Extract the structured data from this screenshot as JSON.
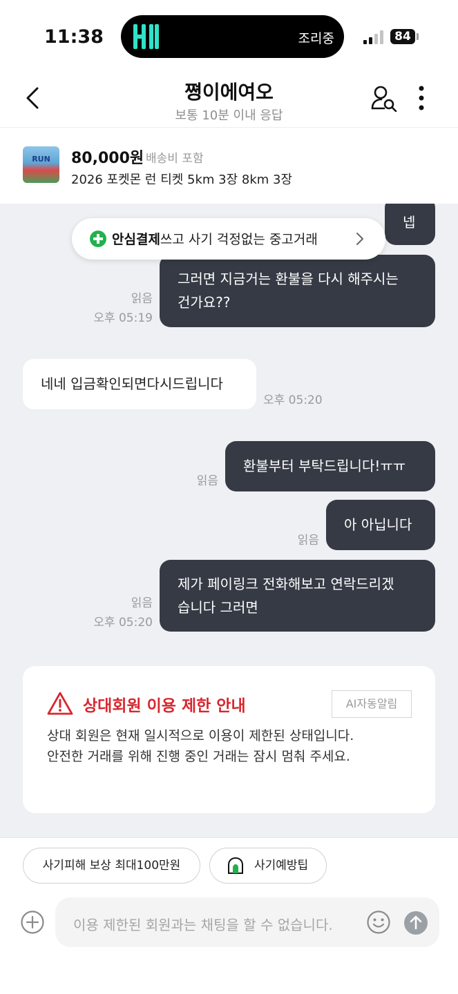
{
  "status_bar": {
    "time": "11:38",
    "live_activity_text": "조리중",
    "battery": "84"
  },
  "header": {
    "title": "쪙이에여오",
    "subtitle": "보통 10분 이내 응답"
  },
  "product": {
    "thumb_text": "RUN",
    "price": "80,000원",
    "shipping": "배송비 포함",
    "name": "2026 포켓몬 런 티켓 5km 3장 8km 3장"
  },
  "safe_pay": {
    "bold": "안심결제",
    "rest": "쓰고 사기 걱정없는 중고거래"
  },
  "messages": {
    "m1": {
      "text": "넵"
    },
    "m2": {
      "line1": "그러면 지금거는 환불을 다시 해주시는",
      "line2": "건가요??",
      "read": "읽음",
      "time": "오후 05:19"
    },
    "m3": {
      "text": "네네 입금확인되면다시드립니다",
      "time": "오후 05:20"
    },
    "m4": {
      "text": "환불부터 부탁드립니다!ㅠㅠ",
      "read": "읽음"
    },
    "m5": {
      "text": "아 아닙니다",
      "read": "읽음"
    },
    "m6": {
      "line1": "제가 페이링크 전화해보고 연락드리겠",
      "line2": "습니다 그러면",
      "read": "읽음",
      "time": "오후 05:20"
    }
  },
  "notice": {
    "title": "상대회원 이용 제한 안내",
    "badge": "AI자동알림",
    "line1": "상대 회원은 현재 일시적으로 이용이 제한된 상태입니다.",
    "line2": "안전한 거래를 위해 진행 중인 거래는 잠시 멈춰 주세요."
  },
  "chips": {
    "compensation": "사기피해 보상 최대100만원",
    "tips": "사기예방팁"
  },
  "composer": {
    "placeholder": "이용 제한된 회원과는 채팅을 할 수 없습니다."
  },
  "colors": {
    "accent_green": "#22b14c",
    "warning_red": "#d8262f",
    "my_bubble": "#353a45",
    "chat_bg": "#eef0f3"
  },
  "icons": [
    "back-icon",
    "profile-search-icon",
    "more-vertical-icon",
    "plus-circle-icon",
    "warning-icon",
    "shield-icon",
    "emoji-icon",
    "send-icon",
    "chevron-right-icon"
  ]
}
